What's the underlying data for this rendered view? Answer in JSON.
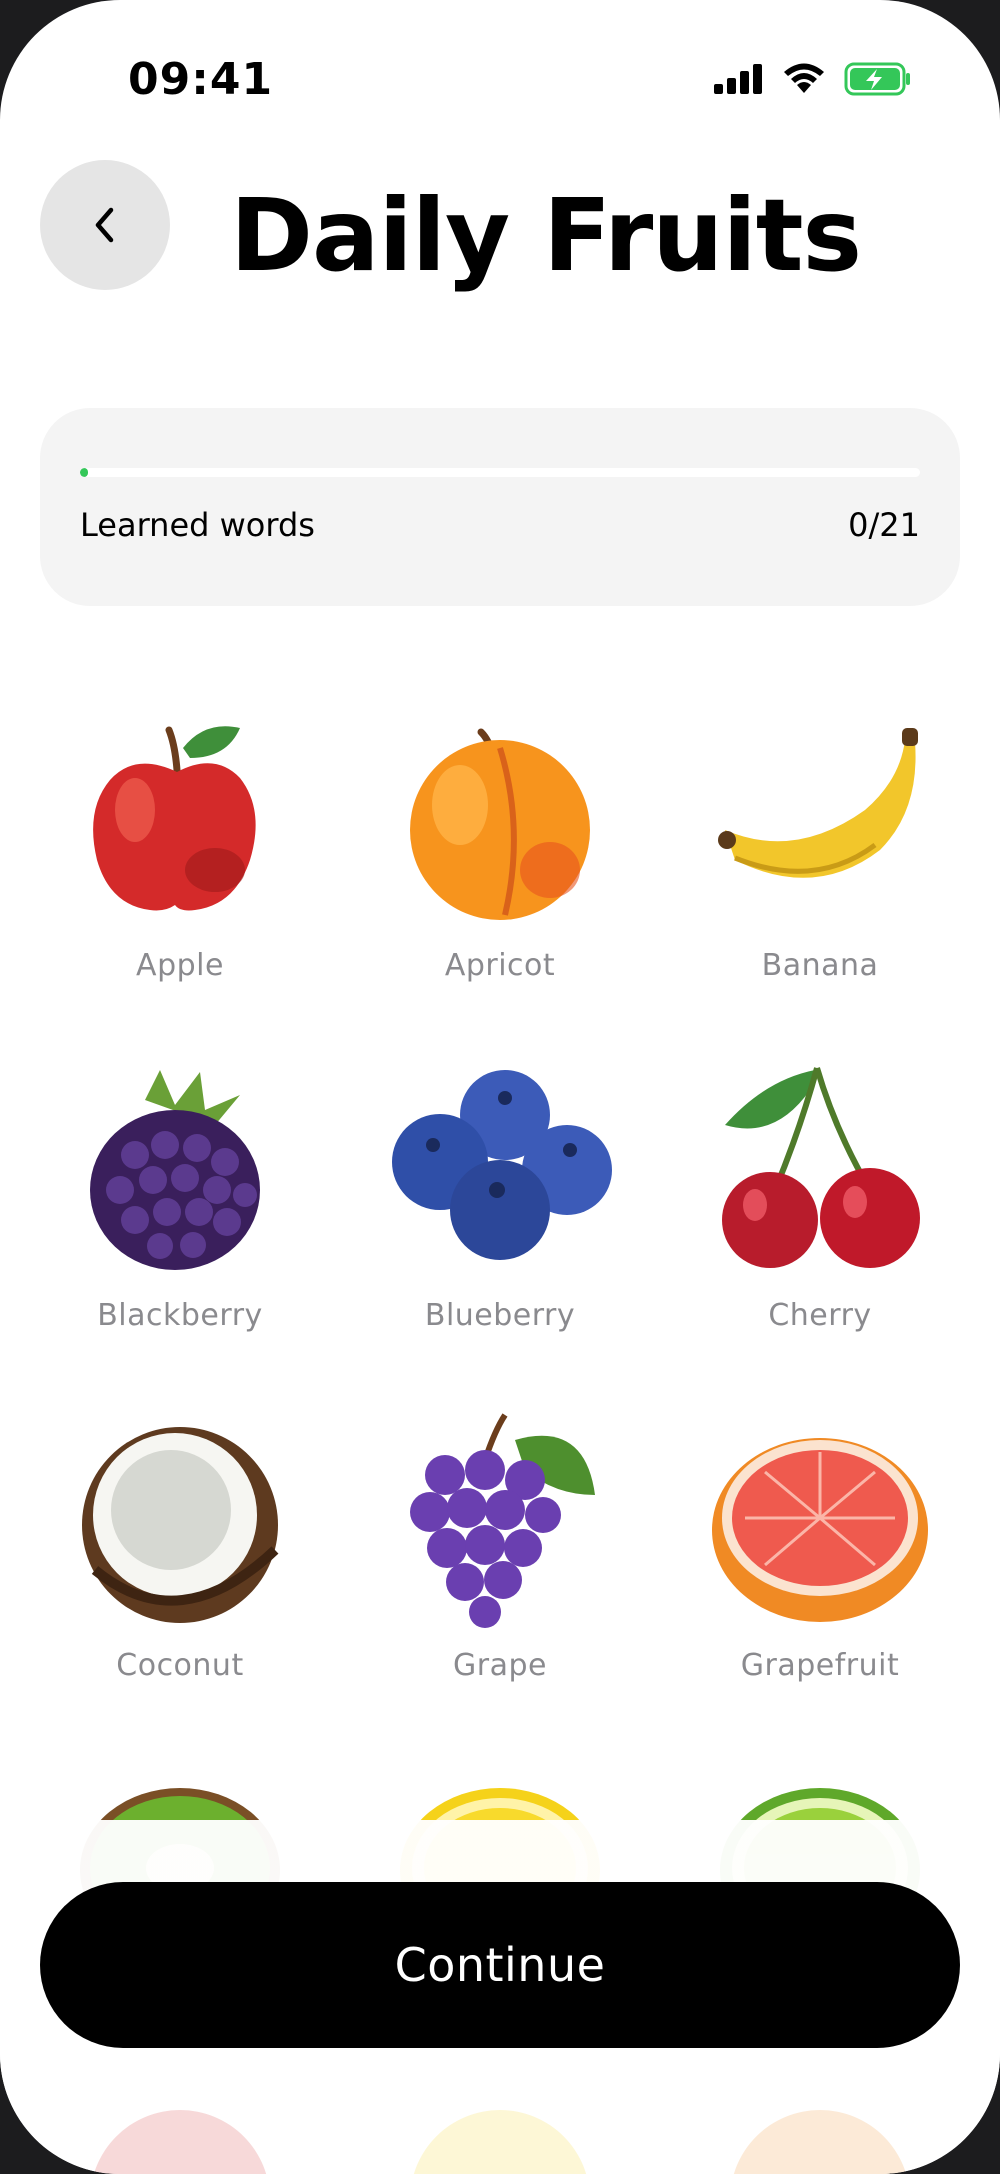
{
  "status_bar": {
    "time": "09:41",
    "icons": [
      "cellular-signal-icon",
      "wifi-icon",
      "battery-charging-icon"
    ],
    "battery_color": "#34c759"
  },
  "header": {
    "back_icon": "chevron-left-icon",
    "title": "Daily Fruits"
  },
  "progress": {
    "label": "Learned words",
    "count_text": "0/21",
    "learned": 0,
    "total": 21,
    "fill_fraction": 0.01,
    "fill_color": "#34c759"
  },
  "fruits": [
    {
      "label": "Apple"
    },
    {
      "label": "Apricot"
    },
    {
      "label": "Banana"
    },
    {
      "label": "Blackberry"
    },
    {
      "label": "Blueberry"
    },
    {
      "label": "Cherry"
    },
    {
      "label": "Coconut"
    },
    {
      "label": "Grape"
    },
    {
      "label": "Grapefruit"
    },
    {
      "label": ""
    },
    {
      "label": ""
    },
    {
      "label": ""
    }
  ],
  "footer": {
    "continue_label": "Continue"
  }
}
